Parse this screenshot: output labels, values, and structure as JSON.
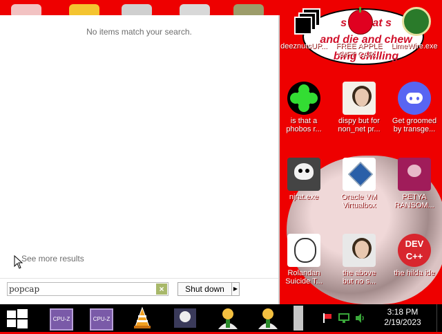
{
  "start_menu": {
    "no_results_text": "No items match your search.",
    "see_more": "See more results",
    "search": {
      "value": "popcap",
      "clear_symbol": "×"
    },
    "shutdown_label": "Shut down",
    "shutdown_arrow": "▶"
  },
  "speech_bubble": {
    "line1": "s tin   eat s",
    "line2": "and die and chew",
    "line3": "bing chilling"
  },
  "desktop_icons": [
    {
      "id": "deeznuts",
      "line1": "deeznutsUP...",
      "line2": ""
    },
    {
      "id": "free-apple",
      "line1": "FREE APPLE",
      "line2": "GIFT CAR..."
    },
    {
      "id": "limewire",
      "line1": "LimeWire.exe",
      "line2": ""
    },
    {
      "id": "is-that-a",
      "line1": "is that a",
      "line2": "phobos r..."
    },
    {
      "id": "dispy",
      "line1": "dispy but for",
      "line2": "non_net pr..."
    },
    {
      "id": "discord",
      "line1": "Get groomed",
      "line2": "by transge..."
    },
    {
      "id": "njrat",
      "line1": "njrat.exe",
      "line2": ""
    },
    {
      "id": "virtualbox",
      "line1": "Oracle VM",
      "line2": "Virtualbox"
    },
    {
      "id": "petya",
      "line1": "PETYA",
      "line2": "RANSOM..."
    },
    {
      "id": "rolandan",
      "line1": "Rolandan",
      "line2": "Suicide T..."
    },
    {
      "id": "the-above",
      "line1": "the above",
      "line2": "but no s..."
    },
    {
      "id": "devcpp",
      "line1": "the hilda ide",
      "line2": "",
      "badge": "DEV C++"
    }
  ],
  "taskbar": {
    "items": [
      {
        "id": "cpuz-1",
        "label": "CPU-Z"
      },
      {
        "id": "cpuz-2",
        "label": "CPU-Z"
      },
      {
        "id": "vlc",
        "label": ""
      },
      {
        "id": "skull",
        "label": ""
      },
      {
        "id": "user-1",
        "label": ""
      },
      {
        "id": "user-2",
        "label": ""
      }
    ],
    "clock_time": "3:18 PM",
    "clock_date": "2/19/2023"
  },
  "colors": {
    "desktop_bg": "#ee0000",
    "taskbar_bg": "#000000",
    "search_clear_bg": "#a8b86a"
  }
}
